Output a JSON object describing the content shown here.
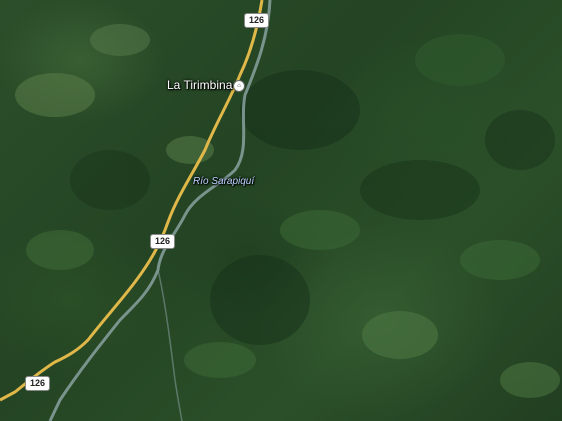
{
  "map": {
    "type": "satellite",
    "places": [
      {
        "name": "La Tirimbina"
      }
    ],
    "rivers": [
      {
        "name": "Río Sarapiquí"
      }
    ],
    "roads": [
      {
        "shield": "126"
      },
      {
        "shield": "126"
      },
      {
        "shield": "126"
      }
    ],
    "poi_icon": "poi-building-icon",
    "colors": {
      "forest": "#2c4f2a",
      "road": "#e0b84a",
      "river": "#8fa7a8",
      "label_text": "#ffffff",
      "river_text": "#bcd4ff"
    }
  }
}
